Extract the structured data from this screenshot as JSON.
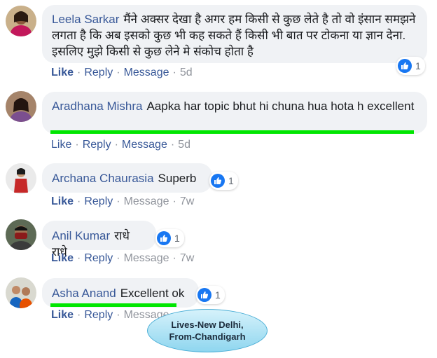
{
  "actions": {
    "like": "Like",
    "reply": "Reply",
    "message": "Message",
    "separator": "·"
  },
  "comments": [
    {
      "name": "Leela Sarkar",
      "text": "मैंने अक्सर देखा है अगर हम किसी से कुछ लेते है तो वो इंसान समझने लगता है कि अब इसको कुछ भी कह सकते हैं किसी भी बात पर टोकना या ज्ञान देना. इसलिए मुझे किसी से कुछ लेने मे संकोच होता है",
      "reactions": "1",
      "time": "5d"
    },
    {
      "name": "Aradhana Mishra",
      "text": "Aapka har topic bhut hi chuna hua hota h excellent",
      "time": "5d"
    },
    {
      "name": "Archana Chaurasia",
      "text": "Superb",
      "reactions": "1",
      "time": "7w"
    },
    {
      "name": "Anil Kumar",
      "text": "राधे राधे",
      "reactions": "1",
      "time": "7w"
    },
    {
      "name": "Asha Anand",
      "text": "Excellent ok",
      "reactions": "1"
    }
  ],
  "tooltip": {
    "line1": "Lives-New Delhi,",
    "line2": "From-Chandigarh"
  },
  "colors": {
    "name": "#385898",
    "bubble": "#f0f2f5",
    "like_badge": "#1877f2",
    "highlight_underline": "#00e600"
  },
  "icons": {
    "reaction": "thumbs-up-icon"
  }
}
